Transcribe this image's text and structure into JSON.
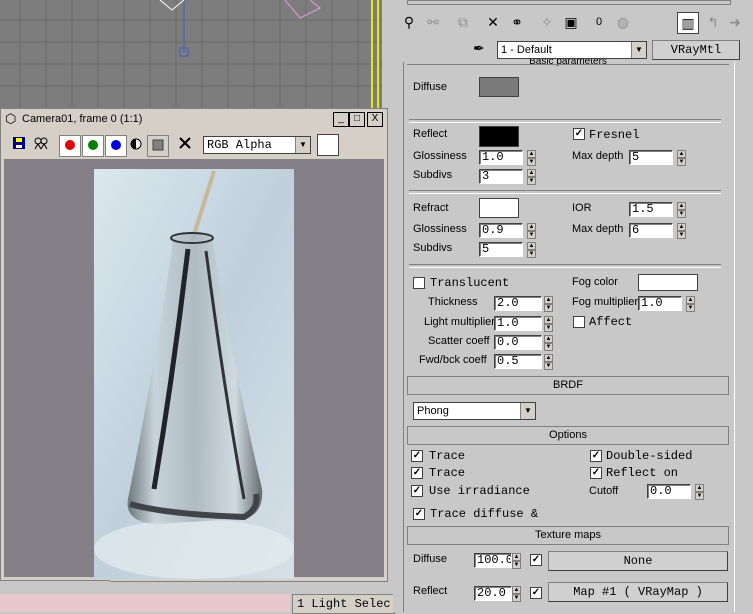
{
  "vfb": {
    "title": "Camera01, frame 0 (1:1)",
    "channel": "RGB Alpha",
    "controls": {
      "min": "_",
      "max": "□",
      "close": "X"
    }
  },
  "panel": {
    "material_name": "1 - Default",
    "material_type": "VRayMtl",
    "rollout_title": "Basic parameters",
    "diffuse_label": "Diffuse",
    "diffuse_color": "#7a7a7a",
    "reflect_label": "Reflect",
    "reflect_color": "#000000",
    "fresnel_label": "Fresnel",
    "reflect_glossiness_label": "Glossiness",
    "reflect_glossiness": "1.0",
    "reflect_subdivs_label": "Subdivs",
    "reflect_subdivs": "3",
    "reflect_maxdepth_label": "Max depth",
    "reflect_maxdepth": "5",
    "refract_label": "Refract",
    "refract_color": "#ffffff",
    "ior_label": "IOR",
    "ior": "1.5",
    "refract_glossiness_label": "Glossiness",
    "refract_glossiness": "0.9",
    "refract_maxdepth_label": "Max depth",
    "refract_maxdepth": "6",
    "refract_subdivs_label": "Subdivs",
    "refract_subdivs": "5",
    "translucent_label": "Translucent",
    "fog_color_label": "Fog color",
    "fog_color": "#ffffff",
    "thickness_label": "Thickness",
    "thickness": "2.0",
    "fog_multiplier_label": "Fog multiplier",
    "fog_multiplier": "1.0",
    "light_multiplier_label": "Light multiplier",
    "light_multiplier": "1.0",
    "affect_label": "Affect",
    "scatter_coeff_label": "Scatter coeff",
    "scatter_coeff": "0.0",
    "fwd_bck_coeff_label": "Fwd/bck coeff",
    "fwd_bck_coeff": "0.5",
    "brdf_title": "BRDF",
    "brdf_type": "Phong",
    "options_title": "Options",
    "trace_reflections_label": "Trace",
    "double_sided_label": "Double-sided",
    "trace_refractions_label": "Trace",
    "reflect_on_label": "Reflect on",
    "use_irradiance_label": "Use irradiance",
    "cutoff_label": "Cutoff",
    "cutoff": "0.0",
    "trace_diffuse_label": "Trace diffuse &",
    "texture_maps_title": "Texture maps",
    "tm_diffuse_label": "Diffuse",
    "tm_diffuse_amount": "100.0",
    "tm_diffuse_map": "None",
    "tm_reflect_label": "Reflect",
    "tm_reflect_amount": "20.0",
    "tm_reflect_map": "Map #1  ( VRayMap )"
  },
  "status": {
    "selection": "1 Light Selec"
  },
  "icons": [
    "save-icon",
    "clone-icon",
    "red-channel-icon",
    "green-channel-icon",
    "blue-channel-icon",
    "mono-icon",
    "alpha-icon",
    "clear-icon",
    "eyedropper-icon"
  ]
}
